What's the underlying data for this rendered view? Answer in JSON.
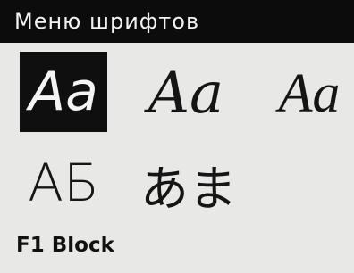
{
  "window": {
    "title": "Меню шрифтов"
  },
  "fonts": [
    {
      "sample": "Aa",
      "selected": true
    },
    {
      "sample": "Aa",
      "selected": false
    },
    {
      "sample": "Aa",
      "selected": false
    },
    {
      "sample": "АБ",
      "selected": false
    },
    {
      "sample": "あま",
      "selected": false
    }
  ],
  "status": {
    "text": "F1 Block"
  },
  "colors": {
    "background": "#e8e8e6",
    "titlebar": "#0c0c0c",
    "selection": "#0f0f0f"
  }
}
